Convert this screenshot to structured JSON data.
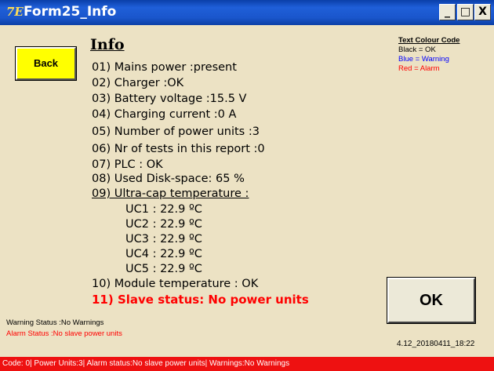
{
  "window": {
    "title": "Form25_Info",
    "app_icon": "7E",
    "controls": {
      "minimize": "_",
      "maximize": "□",
      "close": "X"
    }
  },
  "back_label": "Back",
  "heading": "Info",
  "info_lines": [
    "01) Mains power :present",
    "02) Charger :OK",
    "03) Battery voltage :15.5 V",
    "04) Charging current :0 A",
    "05) Number  of power units :3",
    "06) Nr of tests in this report :0",
    "07) PLC : OK",
    "08) Used Disk-space: 65 %",
    "09) Ultra-cap temperature :",
    "UC1 : 22.9 ºC",
    "UC2 : 22.9 ºC",
    "UC3 : 22.9 ºC",
    "UC4 : 22.9 ºC",
    "UC5 : 22.9 ºC",
    "10) Module temperature : OK",
    "11) Slave status: No power units"
  ],
  "legend": {
    "title": "Text Colour Code",
    "black": "Black = OK",
    "blue": "Blue = Warning",
    "red": "Red = Alarm"
  },
  "ok_label": "OK",
  "warning_status": "Warning Status :No Warnings",
  "alarm_status": "Alarm Status :No slave power units",
  "version": "4.12_20180411_18:22",
  "statusbar": "Code: 0| Power Units:3|  Alarm status:No slave power units| Warnings:No Warnings",
  "colors": {
    "titlebar": "#1a56cc",
    "background": "#ECE2C4",
    "back_button": "#FFFF00",
    "alarm": "#FF0000",
    "warning": "#0000FF",
    "statusbar": "#EE1111"
  }
}
